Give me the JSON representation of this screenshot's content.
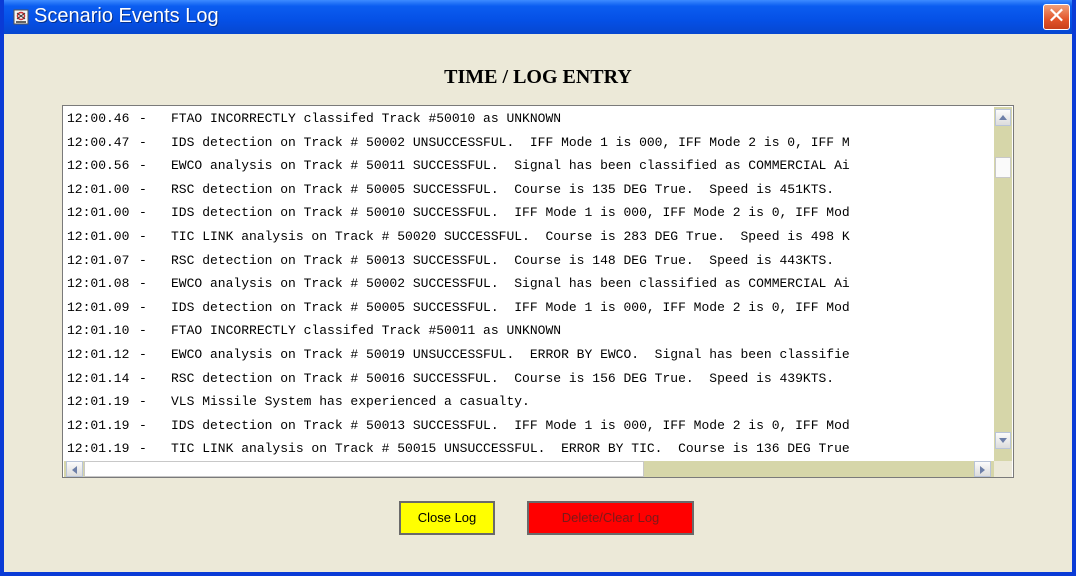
{
  "window": {
    "title": "Scenario Events Log",
    "close_glyph": "✕"
  },
  "heading": "TIME / LOG ENTRY",
  "log": [
    {
      "time": "12:00.46",
      "sep": "-",
      "text": "FTAO INCORRECTLY classifed Track #50010 as UNKNOWN"
    },
    {
      "time": "12:00.47",
      "sep": "-",
      "text": "IDS detection on Track # 50002 UNSUCCESSFUL.  IFF Mode 1 is 000, IFF Mode 2 is 0, IFF M"
    },
    {
      "time": "12:00.56",
      "sep": "-",
      "text": "EWCO analysis on Track # 50011 SUCCESSFUL.  Signal has been classified as COMMERCIAL Ai"
    },
    {
      "time": "12:01.00",
      "sep": "-",
      "text": "RSC detection on Track # 50005 SUCCESSFUL.  Course is 135 DEG True.  Speed is 451KTS."
    },
    {
      "time": "12:01.00",
      "sep": "-",
      "text": "IDS detection on Track # 50010 SUCCESSFUL.  IFF Mode 1 is 000, IFF Mode 2 is 0, IFF Mod"
    },
    {
      "time": "12:01.00",
      "sep": "-",
      "text": "TIC LINK analysis on Track # 50020 SUCCESSFUL.  Course is 283 DEG True.  Speed is 498 K"
    },
    {
      "time": "12:01.07",
      "sep": "-",
      "text": "RSC detection on Track # 50013 SUCCESSFUL.  Course is 148 DEG True.  Speed is 443KTS."
    },
    {
      "time": "12:01.08",
      "sep": "-",
      "text": "EWCO analysis on Track # 50002 SUCCESSFUL.  Signal has been classified as COMMERCIAL Ai"
    },
    {
      "time": "12:01.09",
      "sep": "-",
      "text": "IDS detection on Track # 50005 SUCCESSFUL.  IFF Mode 1 is 000, IFF Mode 2 is 0, IFF Mod"
    },
    {
      "time": "12:01.10",
      "sep": "-",
      "text": "FTAO INCORRECTLY classifed Track #50011 as UNKNOWN"
    },
    {
      "time": "12:01.12",
      "sep": "-",
      "text": "EWCO analysis on Track # 50019 UNSUCCESSFUL.  ERROR BY EWCO.  Signal has been classifie"
    },
    {
      "time": "12:01.14",
      "sep": "-",
      "text": "RSC detection on Track # 50016 SUCCESSFUL.  Course is 156 DEG True.  Speed is 439KTS."
    },
    {
      "time": "12:01.19",
      "sep": "-",
      "text": "VLS Missile System has experienced a casualty."
    },
    {
      "time": "12:01.19",
      "sep": "-",
      "text": "IDS detection on Track # 50013 SUCCESSFUL.  IFF Mode 1 is 000, IFF Mode 2 is 0, IFF Mod"
    },
    {
      "time": "12:01.19",
      "sep": "-",
      "text": "TIC LINK analysis on Track # 50015 UNSUCCESSFUL.  ERROR BY TIC.  Course is 136 DEG True"
    }
  ],
  "scroll": {
    "vertical_position": 0.0,
    "horizontal_position": 0.0
  },
  "buttons": {
    "close_label": "Close Log",
    "clear_label": "Delete/Clear Log"
  },
  "colors": {
    "title_bar": "#0550e6",
    "close_button": "#ffff00",
    "clear_button": "#ff0000",
    "scroll_track": "#d6d6a9"
  },
  "icons": {
    "app": "app-icon",
    "close": "close-icon",
    "up": "scroll-up-arrow-icon",
    "down": "scroll-down-arrow-icon",
    "left": "scroll-left-arrow-icon",
    "right": "scroll-right-arrow-icon"
  }
}
